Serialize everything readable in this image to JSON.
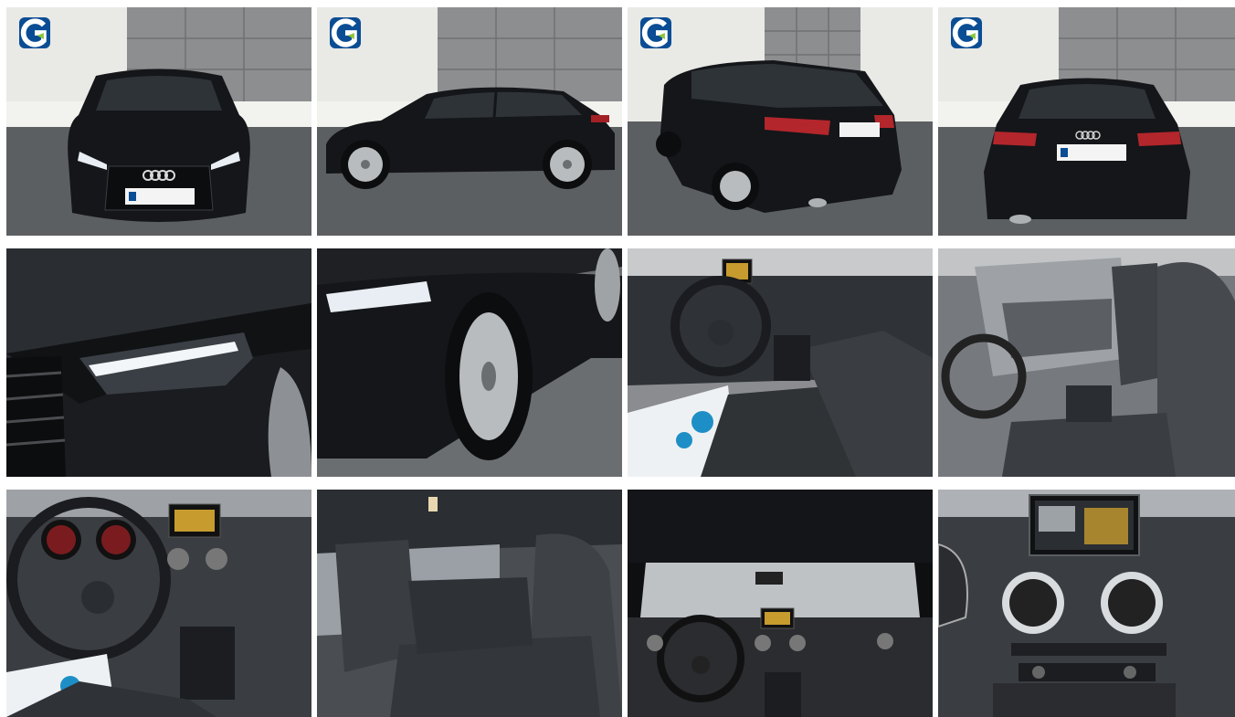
{
  "gallery": {
    "photos": [
      {
        "id": "front-view"
      },
      {
        "id": "side-view"
      },
      {
        "id": "rear-three-quarter-view"
      },
      {
        "id": "rear-view"
      },
      {
        "id": "headlight-detail"
      },
      {
        "id": "front-wheel-detail"
      },
      {
        "id": "driver-interior"
      },
      {
        "id": "front-seats"
      },
      {
        "id": "dashboard-steering-wheel"
      },
      {
        "id": "rear-seats"
      },
      {
        "id": "cockpit-overview"
      },
      {
        "id": "center-console-vents"
      }
    ]
  },
  "colors": {
    "car_body": "#141619",
    "dealer_logo": "#0a4d94",
    "wall": "#e9e9e6",
    "panel": "#8a8c8e",
    "ground": "#5c5f62"
  }
}
